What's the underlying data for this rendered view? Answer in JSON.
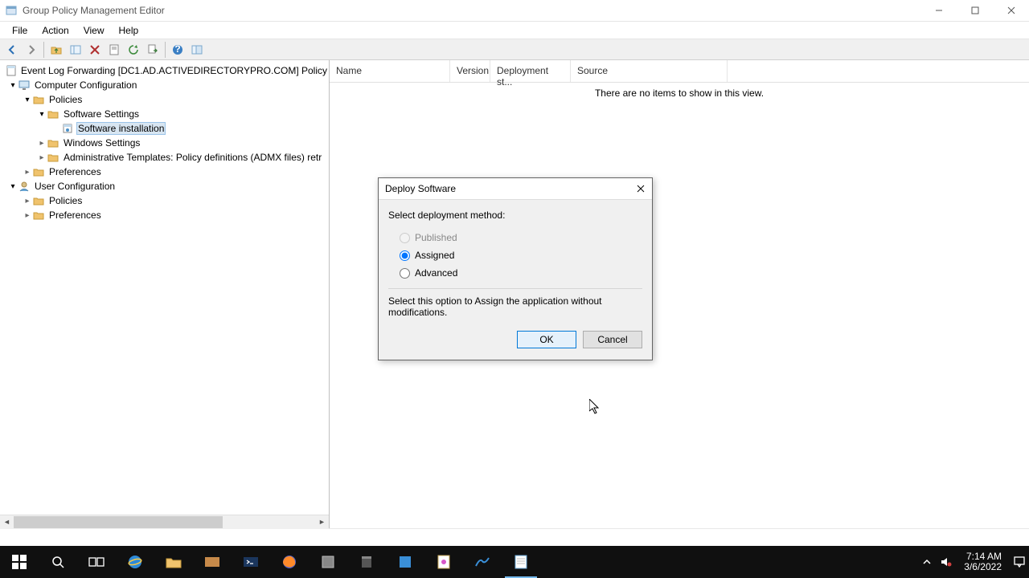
{
  "window": {
    "title": "Group Policy Management Editor"
  },
  "menu": {
    "file": "File",
    "action": "Action",
    "view": "View",
    "help": "Help"
  },
  "tree": {
    "root": "Event Log Forwarding [DC1.AD.ACTIVEDIRECTORYPRO.COM] Policy",
    "computer_config": "Computer Configuration",
    "policies": "Policies",
    "software_settings": "Software Settings",
    "software_installation": "Software installation",
    "windows_settings": "Windows Settings",
    "admin_templates": "Administrative Templates: Policy definitions (ADMX files) retr",
    "preferences": "Preferences",
    "user_config": "User Configuration",
    "user_policies": "Policies",
    "user_preferences": "Preferences"
  },
  "list": {
    "cols": {
      "name": "Name",
      "version": "Version",
      "deployment": "Deployment st...",
      "source": "Source"
    },
    "empty": "There are no items to show in this view."
  },
  "dialog": {
    "title": "Deploy Software",
    "prompt": "Select deployment method:",
    "opt_published": "Published",
    "opt_assigned": "Assigned",
    "opt_advanced": "Advanced",
    "desc": "Select this option to Assign the application without modifications.",
    "ok": "OK",
    "cancel": "Cancel"
  },
  "tray": {
    "time": "7:14 AM",
    "date": "3/6/2022"
  }
}
